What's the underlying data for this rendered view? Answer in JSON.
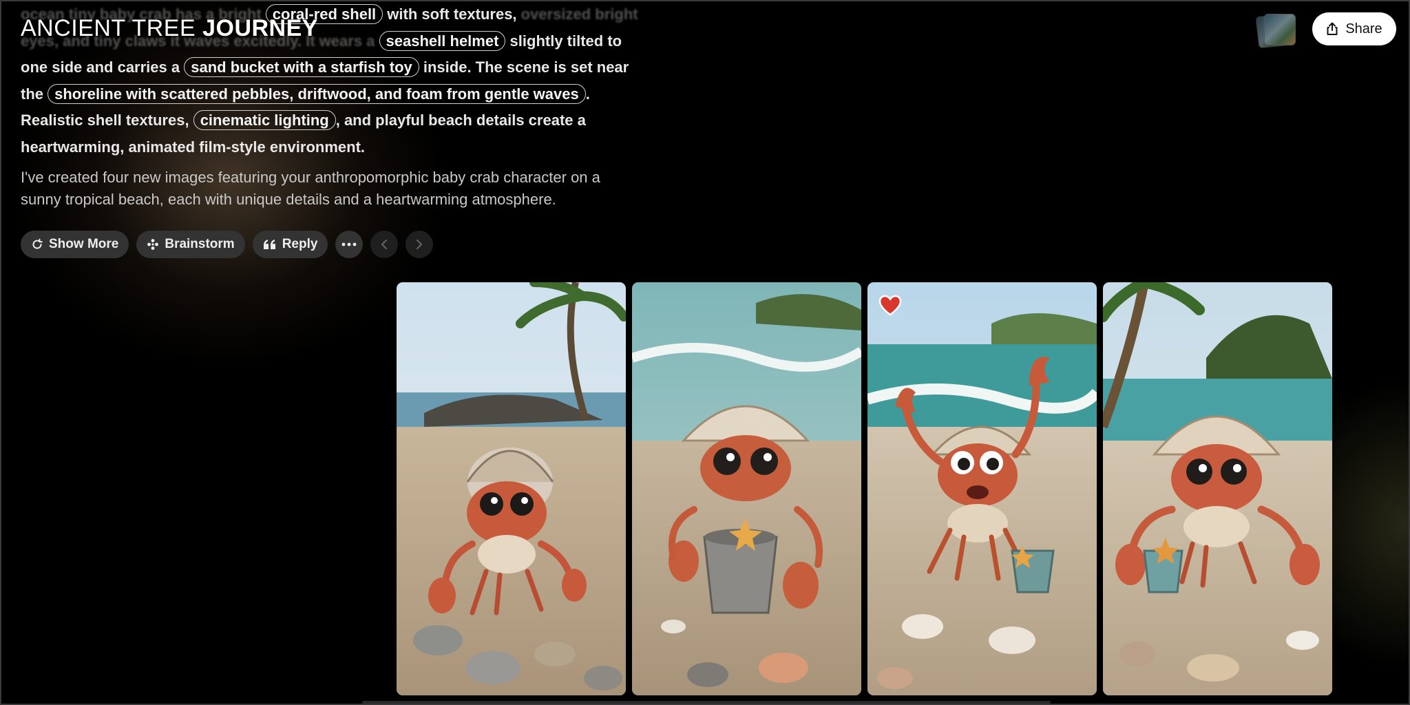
{
  "header": {
    "brand_light": "ANCIENT TREE",
    "brand_bold": "JOURNEY",
    "share_label": "Share"
  },
  "prompt": {
    "t0": "ocean tiny baby crab has a bright",
    "chip_shell": "coral-red shell",
    "t1": "with soft textures,",
    "t2": "oversized bright eyes, and tiny claws it waves excitedly. It wears a",
    "chip_helmet": "seashell helmet",
    "t3": "slightly tilted to one side and carries a",
    "chip_bucket": "sand bucket with a starfish toy",
    "t4": "inside. The scene is set near the",
    "chip_shore": "shoreline with scattered pebbles, driftwood, and foam from gentle waves",
    "t5": ". Realistic shell textures,",
    "chip_light": "cinematic lighting",
    "t6": ", and playful beach details create a heartwarming, animated film-style environment."
  },
  "reply": {
    "text": "I've created four new images featuring your anthropomorphic baby crab character on a sunny tropical beach, each with unique details and a heartwarming atmosphere."
  },
  "toolbar": {
    "show_more": "Show More",
    "brainstorm": "Brainstorm",
    "reply": "Reply"
  },
  "gallery": {
    "images": [
      {
        "name": "crab-image-1",
        "liked": false
      },
      {
        "name": "crab-image-2",
        "liked": false
      },
      {
        "name": "crab-image-3",
        "liked": true
      },
      {
        "name": "crab-image-4",
        "liked": false
      }
    ]
  },
  "colors": {
    "heart": "#d9372b",
    "pill_bg": "#333333",
    "share_bg": "#ffffff"
  }
}
